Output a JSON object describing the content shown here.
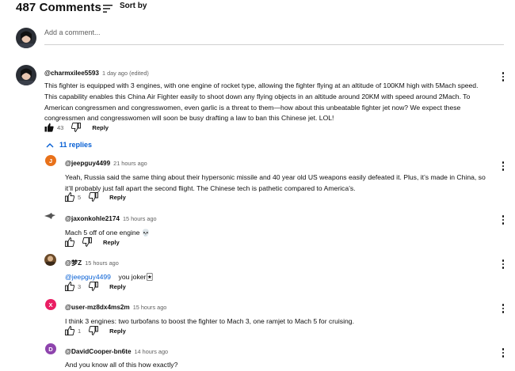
{
  "header": {
    "comment_count": "487 Comments",
    "sort_label": "Sort by"
  },
  "composer": {
    "placeholder": "Add a comment..."
  },
  "top_comment": {
    "author": "@charmxilee5593",
    "time": "1 day ago (edited)",
    "text": "This fighter is equipped with 3 engines, with one engine of rocket type, allowing the fighter flying at an altitude of 100KM high with 5Mach speed. This capability enables this China Air Fighter easily to shoot down any flying objects in an altitude around 20KM with speed around 2Mach.  To American congressmen and congresswomen, even garlic is  a threat to them—how about this unbeatable fighter jet now? We expect these congressmen and congresswomen will soon be busy drafting a law to ban this Chinese jet. LOL!",
    "likes": "43",
    "reply_label": "Reply"
  },
  "replies_toggle": "11 replies",
  "replies": [
    {
      "author": "@jeepguy4499",
      "time": "21 hours ago",
      "avatar_letter": "J",
      "avatar_color": "#e8711a",
      "text": "Yeah, Russia said the same thing about their hypersonic missile and 40 year old US weapons easily defeated it. Plus, it’s made in China, so it’ll probably just fall apart the second flight. The Chinese tech is pathetic compared to America’s.",
      "likes": "5",
      "reply_label": "Reply"
    },
    {
      "author": "@jaxonkohle2174",
      "time": "15 hours ago",
      "avatar_letter": "",
      "avatar_color": "#ffffff",
      "text": "Mach 5 off of one engine 💀",
      "likes": "",
      "reply_label": "Reply"
    },
    {
      "author": "@梦Z",
      "time": "15 hours ago",
      "avatar_letter": "",
      "avatar_color": "#6b4b2a",
      "mention": "@jeepguy4499",
      "text": "you joker🃏",
      "likes": "3",
      "reply_label": "Reply"
    },
    {
      "author": "@user-mz8dx4ms2m",
      "time": "15 hours ago",
      "avatar_letter": "X",
      "avatar_color": "#e91e63",
      "text": "I think 3 engines: two turbofans to boost the fighter to Mach 3, one ramjet to Mach 5 for cruising.",
      "likes": "1",
      "reply_label": "Reply"
    },
    {
      "author": "@DavidCooper-bn6te",
      "time": "14 hours ago",
      "avatar_letter": "D",
      "avatar_color": "#8e44ad",
      "text": "And you know all of this how exactly?",
      "likes": "",
      "reply_label": "Reply"
    }
  ]
}
